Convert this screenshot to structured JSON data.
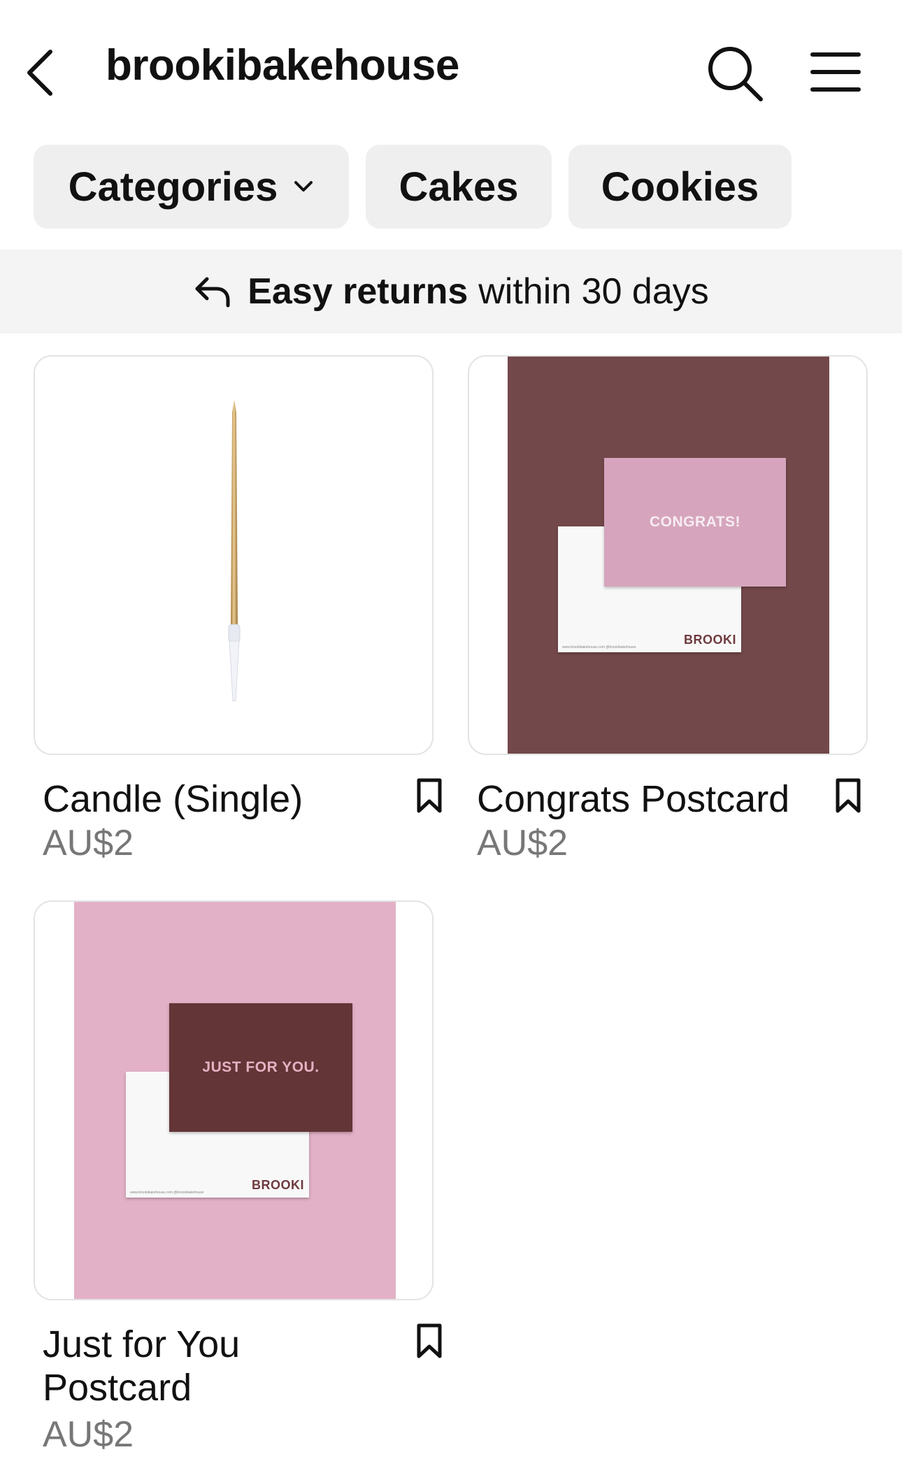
{
  "header": {
    "title": "brookibakehouse",
    "icons": [
      "chevron-left-icon",
      "search-icon",
      "hamburger-menu-icon"
    ]
  },
  "chips": {
    "categories": "Categories",
    "cakes": "Cakes",
    "cookies": "Cookies"
  },
  "returns_banner": {
    "bold": "Easy returns",
    "rest": "within 30 days"
  },
  "products": [
    {
      "name": "Candle (Single)",
      "price": "AU$2"
    },
    {
      "name": "Congrats Postcard",
      "price": "AU$2",
      "card_text": "CONGRATS!",
      "brand": "BROOKI",
      "fineprint": "www.brookibakehouse.com    @brookibakehouse"
    },
    {
      "name": "Just for You Postcard",
      "price": "AU$2",
      "card_text": "JUST FOR YOU.",
      "brand": "BROOKI",
      "fineprint": "www.brookibakehouse.com    @brookibakehouse"
    }
  ],
  "colors": {
    "chip_bg": "#efefef",
    "banner_bg": "#f4f4f4",
    "maroon": "#73484a",
    "pink": "#e3b1c7",
    "card_pink": "#d6a5bd",
    "card_maroon": "#643537",
    "price_gray": "#777777"
  }
}
